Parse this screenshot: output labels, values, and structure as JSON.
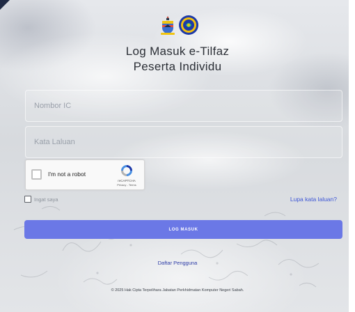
{
  "header": {
    "title_line1": "Log Masuk e-Tilfaz",
    "title_line2": "Peserta Individu"
  },
  "logos": [
    "sabah-crest-logo",
    "jabatan-emblem-logo"
  ],
  "form": {
    "ic_placeholder": "Nombor IC",
    "password_placeholder": "Kata Laluan",
    "captcha_label": "I'm not a robot",
    "captcha_brand": "reCAPTCHA",
    "captcha_links": "Privacy - Terms",
    "remember_label": "Ingat saya",
    "forgot_label": "Lupa kata laluan?",
    "login_label": "LOG MASUK"
  },
  "footer": {
    "register_label": "Daftar Pengguna",
    "copyright": "© 2025 Hak Cipta Terpelihara Jabatan Perkhidmatan Komputer Negeri Sabah."
  },
  "colors": {
    "accent": "#6b78e6",
    "link": "#3d56d6",
    "register_link": "#2f3ea8"
  }
}
